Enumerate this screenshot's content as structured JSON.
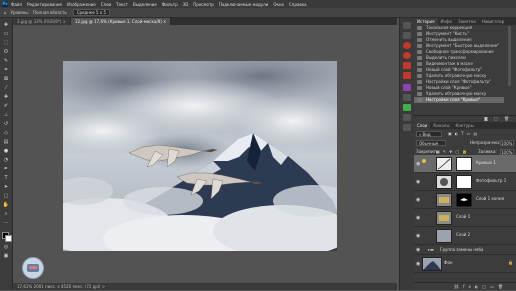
{
  "app": {
    "logo": "Ps"
  },
  "menubar": {
    "items": [
      "Файл",
      "Редактирование",
      "Изображение",
      "Слои",
      "Текст",
      "Выделение",
      "Фильтр",
      "3D",
      "Просмотр",
      "Подключаемые модули",
      "Окно",
      "Справка"
    ]
  },
  "options": {
    "label_1": "Уровень:",
    "label_2": "Полная область",
    "select": "Среднее 5 x 5"
  },
  "tabs": [
    {
      "label": "3.jpg @ 33% (RGB/8*) ×"
    },
    {
      "label": "12.jpg @ 17,6% (Кривые 1, Слой-маска/8) ×"
    }
  ],
  "statusbar": {
    "text": "17,61%   2001 пикс. x 4520 пикс. (72 ppi)  >"
  },
  "panel": {
    "top_tabs": [
      "История",
      "Инфо",
      "Заметки",
      "Навигатор"
    ],
    "history": [
      "Тональная коррекция",
      "Инструмент \"Кисть\"",
      "Отменить выделение",
      "Инструмент \"Быстрое выделение\"",
      "Свободное трансформирование",
      "Выделить пиксели",
      "Видеомонтаж в маске",
      "Новый слой \"Фотофильтр\"",
      "Удалить обтравочную маску",
      "Настройки слоя \"Фотофильтр\"",
      "Новый слой \"Кривые\"",
      "Удалить обтравочную маску",
      "Настройки слоя \"Кривые\""
    ],
    "layer_tabs": [
      "Слои",
      "Каналы",
      "Контуры"
    ],
    "kind": "Вид",
    "blend": "Обычные",
    "opacity_label": "Непрозрачность:",
    "opacity": "100%",
    "lock_label": "Закрепить:",
    "fill_label": "Заливка:",
    "fill": "100%",
    "layers": [
      {
        "name": "Кривые 1",
        "type": "adjust",
        "selected": true
      },
      {
        "name": "Фотофильтр 1",
        "type": "adjust",
        "selected": false
      },
      {
        "name": "Слой 1 копия",
        "type": "mask",
        "selected": false
      },
      {
        "name": "Слой 1",
        "type": "pixel",
        "selected": false
      },
      {
        "name": "Слой 2",
        "type": "pixel",
        "selected": false
      },
      {
        "name": "Группа замены неба",
        "type": "group",
        "selected": false
      },
      {
        "name": "Фон",
        "type": "bg",
        "selected": false
      }
    ]
  }
}
